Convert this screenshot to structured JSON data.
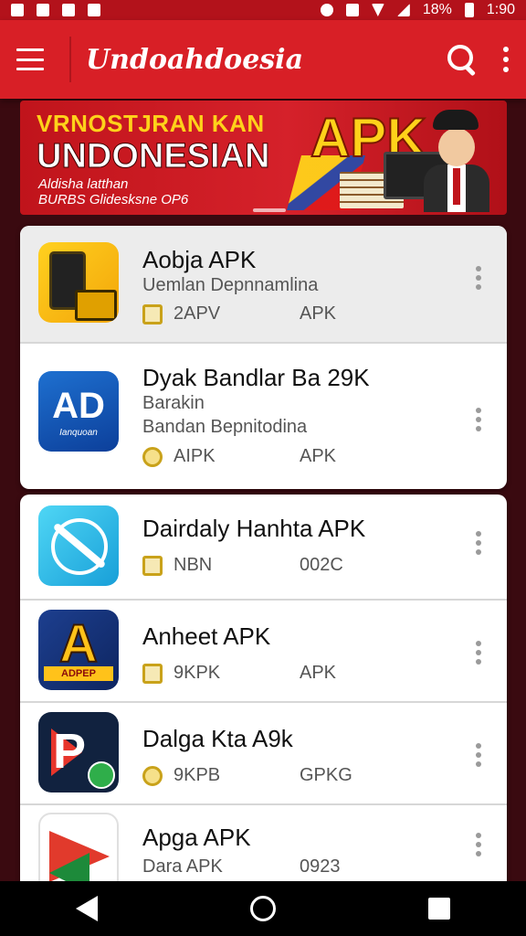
{
  "status_bar": {
    "battery": "18%",
    "time": "1:90"
  },
  "app_bar": {
    "title": "Undoahdoesia"
  },
  "banner": {
    "line1": "VRNOSTJRAN KAN",
    "line2": "UNDONESIAN",
    "line3a": "Aldisha latthan",
    "line3b": "BURBS Glidesksne OP6",
    "badge": "APK"
  },
  "apps": [
    {
      "title": "Aobja APK",
      "subtitle": "Uemlan Depnnamlina",
      "subtitle2": "",
      "meta_left": "2APV",
      "meta_right": "APK",
      "meta_icon": "square"
    },
    {
      "title": "Dyak Bandlar Ba 29K",
      "subtitle": "Barakin",
      "subtitle2": "Bandan Bepnitodina",
      "meta_left": "AIPK",
      "meta_right": "APK",
      "meta_icon": "circle",
      "icon_text": "AD",
      "icon_subtext": "Ianquoan"
    },
    {
      "title": "Dairdaly Hanhta APK",
      "subtitle": "",
      "subtitle2": "",
      "meta_left": "NBN",
      "meta_right": "002C",
      "meta_icon": "square"
    },
    {
      "title": "Anheet APK",
      "subtitle": "",
      "subtitle2": "",
      "meta_left": "9KPK",
      "meta_right": "APK",
      "meta_icon": "square",
      "icon_text": "A",
      "icon_subtext": "ADPEP"
    },
    {
      "title": "Dalga Kta A9k",
      "subtitle": "",
      "subtitle2": "",
      "meta_left": "9KPB",
      "meta_right": "GPKG",
      "meta_icon": "circle"
    },
    {
      "title": "Apga APK",
      "subtitle": "Dara APK",
      "subtitle2": "",
      "meta_left": "",
      "meta_right": "0923",
      "meta_icon": "none"
    }
  ]
}
